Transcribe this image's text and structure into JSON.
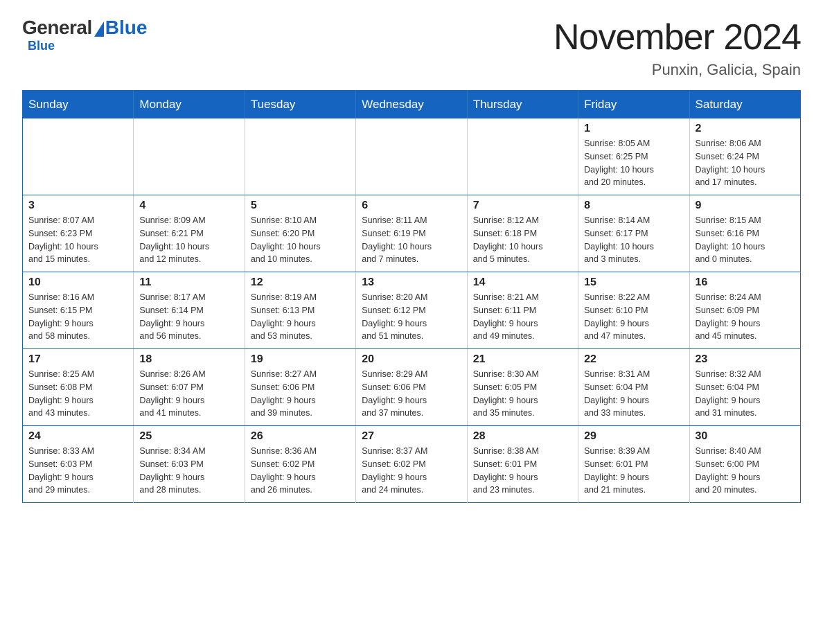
{
  "logo": {
    "general": "General",
    "blue": "Blue"
  },
  "title": "November 2024",
  "location": "Punxin, Galicia, Spain",
  "days_header": [
    "Sunday",
    "Monday",
    "Tuesday",
    "Wednesday",
    "Thursday",
    "Friday",
    "Saturday"
  ],
  "weeks": [
    [
      {
        "day": "",
        "info": ""
      },
      {
        "day": "",
        "info": ""
      },
      {
        "day": "",
        "info": ""
      },
      {
        "day": "",
        "info": ""
      },
      {
        "day": "",
        "info": ""
      },
      {
        "day": "1",
        "info": "Sunrise: 8:05 AM\nSunset: 6:25 PM\nDaylight: 10 hours\nand 20 minutes."
      },
      {
        "day": "2",
        "info": "Sunrise: 8:06 AM\nSunset: 6:24 PM\nDaylight: 10 hours\nand 17 minutes."
      }
    ],
    [
      {
        "day": "3",
        "info": "Sunrise: 8:07 AM\nSunset: 6:23 PM\nDaylight: 10 hours\nand 15 minutes."
      },
      {
        "day": "4",
        "info": "Sunrise: 8:09 AM\nSunset: 6:21 PM\nDaylight: 10 hours\nand 12 minutes."
      },
      {
        "day": "5",
        "info": "Sunrise: 8:10 AM\nSunset: 6:20 PM\nDaylight: 10 hours\nand 10 minutes."
      },
      {
        "day": "6",
        "info": "Sunrise: 8:11 AM\nSunset: 6:19 PM\nDaylight: 10 hours\nand 7 minutes."
      },
      {
        "day": "7",
        "info": "Sunrise: 8:12 AM\nSunset: 6:18 PM\nDaylight: 10 hours\nand 5 minutes."
      },
      {
        "day": "8",
        "info": "Sunrise: 8:14 AM\nSunset: 6:17 PM\nDaylight: 10 hours\nand 3 minutes."
      },
      {
        "day": "9",
        "info": "Sunrise: 8:15 AM\nSunset: 6:16 PM\nDaylight: 10 hours\nand 0 minutes."
      }
    ],
    [
      {
        "day": "10",
        "info": "Sunrise: 8:16 AM\nSunset: 6:15 PM\nDaylight: 9 hours\nand 58 minutes."
      },
      {
        "day": "11",
        "info": "Sunrise: 8:17 AM\nSunset: 6:14 PM\nDaylight: 9 hours\nand 56 minutes."
      },
      {
        "day": "12",
        "info": "Sunrise: 8:19 AM\nSunset: 6:13 PM\nDaylight: 9 hours\nand 53 minutes."
      },
      {
        "day": "13",
        "info": "Sunrise: 8:20 AM\nSunset: 6:12 PM\nDaylight: 9 hours\nand 51 minutes."
      },
      {
        "day": "14",
        "info": "Sunrise: 8:21 AM\nSunset: 6:11 PM\nDaylight: 9 hours\nand 49 minutes."
      },
      {
        "day": "15",
        "info": "Sunrise: 8:22 AM\nSunset: 6:10 PM\nDaylight: 9 hours\nand 47 minutes."
      },
      {
        "day": "16",
        "info": "Sunrise: 8:24 AM\nSunset: 6:09 PM\nDaylight: 9 hours\nand 45 minutes."
      }
    ],
    [
      {
        "day": "17",
        "info": "Sunrise: 8:25 AM\nSunset: 6:08 PM\nDaylight: 9 hours\nand 43 minutes."
      },
      {
        "day": "18",
        "info": "Sunrise: 8:26 AM\nSunset: 6:07 PM\nDaylight: 9 hours\nand 41 minutes."
      },
      {
        "day": "19",
        "info": "Sunrise: 8:27 AM\nSunset: 6:06 PM\nDaylight: 9 hours\nand 39 minutes."
      },
      {
        "day": "20",
        "info": "Sunrise: 8:29 AM\nSunset: 6:06 PM\nDaylight: 9 hours\nand 37 minutes."
      },
      {
        "day": "21",
        "info": "Sunrise: 8:30 AM\nSunset: 6:05 PM\nDaylight: 9 hours\nand 35 minutes."
      },
      {
        "day": "22",
        "info": "Sunrise: 8:31 AM\nSunset: 6:04 PM\nDaylight: 9 hours\nand 33 minutes."
      },
      {
        "day": "23",
        "info": "Sunrise: 8:32 AM\nSunset: 6:04 PM\nDaylight: 9 hours\nand 31 minutes."
      }
    ],
    [
      {
        "day": "24",
        "info": "Sunrise: 8:33 AM\nSunset: 6:03 PM\nDaylight: 9 hours\nand 29 minutes."
      },
      {
        "day": "25",
        "info": "Sunrise: 8:34 AM\nSunset: 6:03 PM\nDaylight: 9 hours\nand 28 minutes."
      },
      {
        "day": "26",
        "info": "Sunrise: 8:36 AM\nSunset: 6:02 PM\nDaylight: 9 hours\nand 26 minutes."
      },
      {
        "day": "27",
        "info": "Sunrise: 8:37 AM\nSunset: 6:02 PM\nDaylight: 9 hours\nand 24 minutes."
      },
      {
        "day": "28",
        "info": "Sunrise: 8:38 AM\nSunset: 6:01 PM\nDaylight: 9 hours\nand 23 minutes."
      },
      {
        "day": "29",
        "info": "Sunrise: 8:39 AM\nSunset: 6:01 PM\nDaylight: 9 hours\nand 21 minutes."
      },
      {
        "day": "30",
        "info": "Sunrise: 8:40 AM\nSunset: 6:00 PM\nDaylight: 9 hours\nand 20 minutes."
      }
    ]
  ]
}
